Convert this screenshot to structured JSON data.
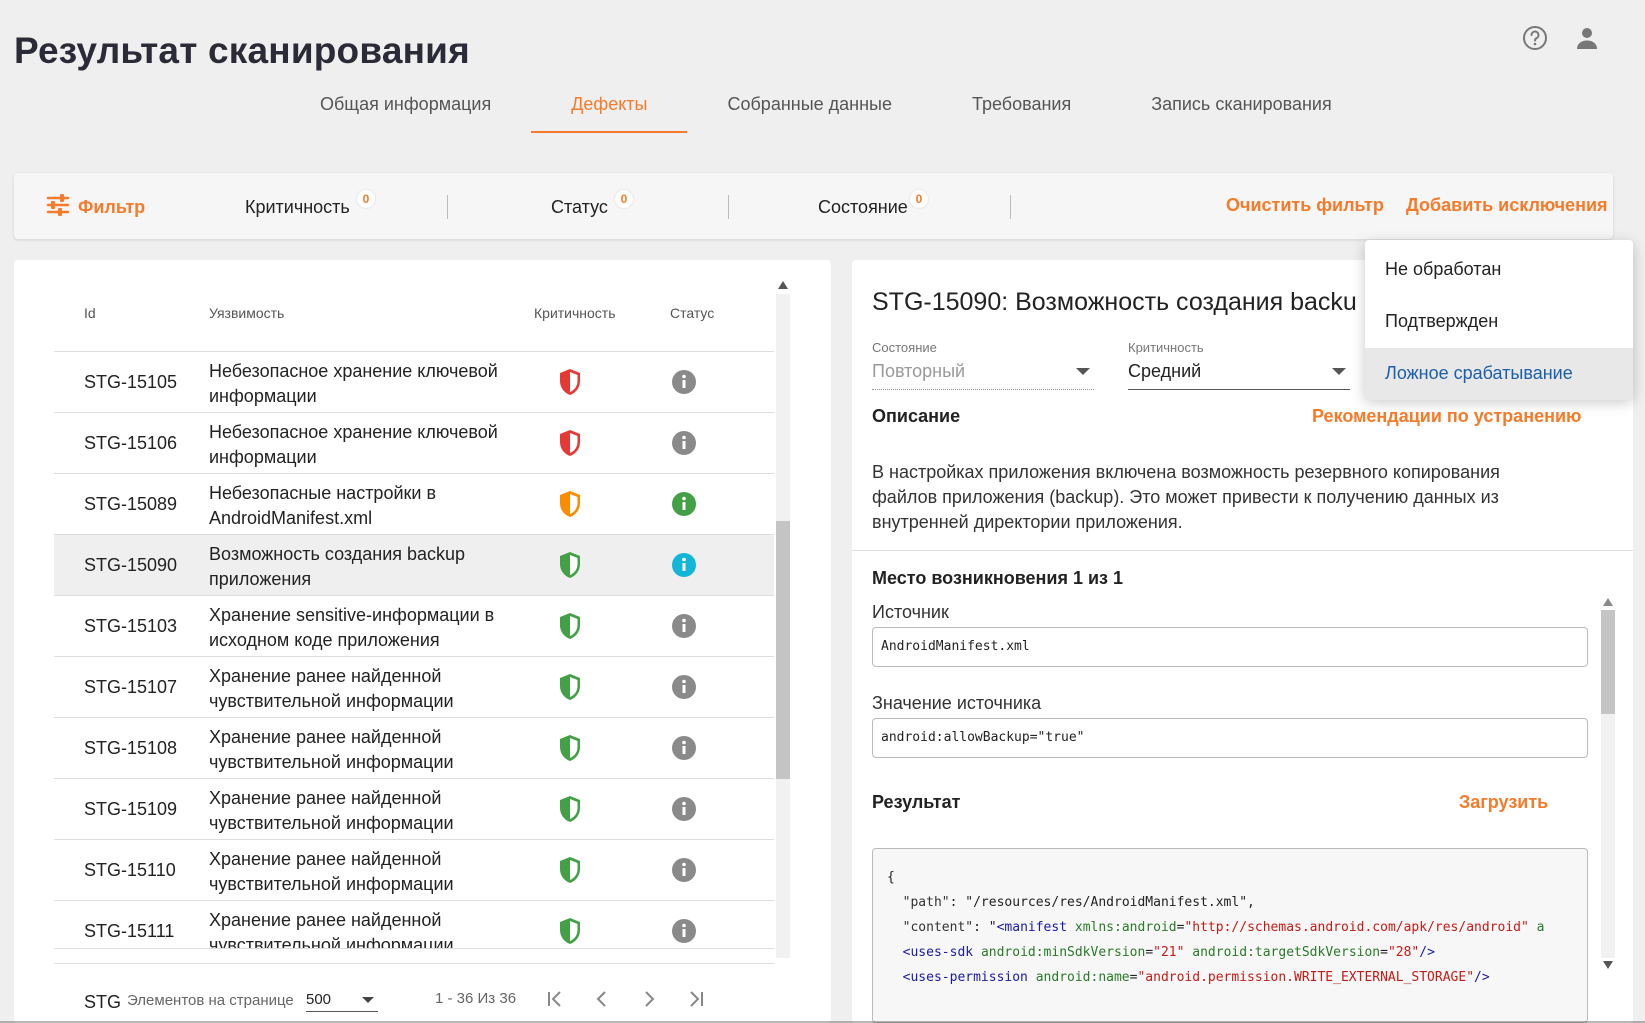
{
  "header": {
    "title": "Результат сканирования",
    "help_icon": "help-circle-icon",
    "user_icon": "user-icon"
  },
  "tabs": [
    {
      "label": "Общая информация",
      "active": false
    },
    {
      "label": "Дефекты",
      "active": true
    },
    {
      "label": "Собранные данные",
      "active": false
    },
    {
      "label": "Требования",
      "active": false
    },
    {
      "label": "Запись сканирования",
      "active": false
    }
  ],
  "filter_bar": {
    "filter_label": "Фильтр",
    "chips": [
      {
        "label": "Критичность",
        "count": "0"
      },
      {
        "label": "Статус",
        "count": "0"
      },
      {
        "label": "Состояние",
        "count": "0"
      }
    ],
    "clear_label": "Очистить фильтр",
    "add_exclusions_label": "Добавить исключения"
  },
  "table": {
    "headers": {
      "id": "Id",
      "vuln": "Уязвимость",
      "crit": "Критичность",
      "status": "Статус"
    },
    "rows": [
      {
        "id": "STG-15105",
        "name": "Небезопасное хранение ключевой информации",
        "crit": "high",
        "status": "none"
      },
      {
        "id": "STG-15106",
        "name": "Небезопасное хранение ключевой информации",
        "crit": "high",
        "status": "none"
      },
      {
        "id": "STG-15089",
        "name": "Небезопасные настройки в AndroidManifest.xml",
        "crit": "medium",
        "status": "confirmed"
      },
      {
        "id": "STG-15090",
        "name": "Возможность создания backup приложения",
        "crit": "low",
        "status": "info",
        "selected": true
      },
      {
        "id": "STG-15103",
        "name": "Хранение sensitive-информации в исходном коде приложения",
        "crit": "low",
        "status": "none"
      },
      {
        "id": "STG-15107",
        "name": "Хранение ранее найденной чувствительной информации",
        "crit": "low",
        "status": "none"
      },
      {
        "id": "STG-15108",
        "name": "Хранение ранее найденной чувствительной информации",
        "crit": "low",
        "status": "none"
      },
      {
        "id": "STG-15109",
        "name": "Хранение ранее найденной чувствительной информации",
        "crit": "low",
        "status": "none"
      },
      {
        "id": "STG-15110",
        "name": "Хранение ранее найденной чувствительной информации",
        "crit": "low",
        "status": "none"
      },
      {
        "id": "STG-15111",
        "name": "Хранение ранее найденной чувствительной информации",
        "crit": "low",
        "status": "none"
      }
    ],
    "peek_id": "STG",
    "colors": {
      "high": "#e53935",
      "medium": "#fb8c00",
      "low": "#43a047",
      "status_none": "#8a8a8a",
      "status_confirmed": "#43a047",
      "status_info": "#13b5d8"
    }
  },
  "pager": {
    "per_page_label": "Элементов на странице",
    "per_page_value": "500",
    "range": "1 - 36 Из 36"
  },
  "detail": {
    "title": "STG-15090: Возможность создания backu",
    "state_label": "Состояние",
    "state_value": "Повторный",
    "crit_label": "Критичность",
    "crit_value": "Средний",
    "description_heading": "Описание",
    "recommendations_link": "Рекомендации по устранению",
    "description": "В настройках приложения включена возможность резервного копирования файлов приложения (backup). Это может привести к получению данных из внутренней директории приложения.",
    "location_heading": "Место возникновения 1 из 1",
    "source_label": "Источник",
    "source_value": "AndroidManifest.xml",
    "source_value_label": "Значение источника",
    "source_value_value": "android:allowBackup=\"true\"",
    "result_heading": "Результат",
    "download_label": "Загрузить",
    "result_code": {
      "l1": "{",
      "l2_key": "\"path\"",
      "l2_val": "\"/resources/res/AndroidManifest.xml\",",
      "l3_key": "\"content\"",
      "l3_pre": "\"",
      "l3_tag": "<manifest",
      "l3_attr": "xmlns:android",
      "l3_val": "\"http://schemas.android.com/apk/res/android\"",
      "l3_more": "a",
      "l4_tag": "<uses-sdk",
      "l4_attr1": "android:minSdkVersion",
      "l4_val1": "\"21\"",
      "l4_attr2": "android:targetSdkVersion",
      "l4_val2": "\"28\"",
      "l4_end": "/>",
      "l5_tag": "<uses-permission",
      "l5_attr": "android:name",
      "l5_val": "\"android.permission.WRITE_EXTERNAL_STORAGE\"",
      "l5_end": "/>"
    }
  },
  "status_dropdown": {
    "options": [
      "Не обработан",
      "Подтвержден",
      "Ложное срабатывание"
    ],
    "highlighted": "Ложное срабатывание"
  },
  "accent_color": "#f57b2a"
}
